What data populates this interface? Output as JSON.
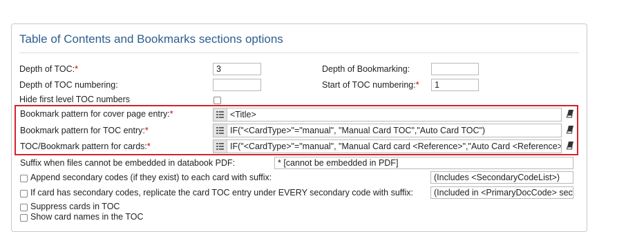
{
  "panel": {
    "title": "Table of Contents and Bookmarks sections options"
  },
  "fields": {
    "depth_toc": {
      "label": "Depth of TOC:",
      "required": "*",
      "value": "3"
    },
    "depth_bookmarking": {
      "label": "Depth of Bookmarking:",
      "value": ""
    },
    "depth_toc_numbering": {
      "label": "Depth of TOC numbering:",
      "value": ""
    },
    "start_toc_numbering": {
      "label": "Start of TOC numbering:",
      "required": "*",
      "value": "1"
    },
    "hide_first_level": {
      "label": "Hide first level TOC numbers",
      "checked": false
    }
  },
  "patterns": {
    "cover": {
      "label": "Bookmark pattern for cover page entry:",
      "required": "*",
      "value": "<Title>"
    },
    "toc": {
      "label": "Bookmark pattern for TOC entry:",
      "required": "*",
      "value": "IF(\"<CardType>\"=\"manual\", \"Manual Card TOC\",\"Auto Card TOC\")"
    },
    "cards": {
      "label": "TOC/Bookmark pattern for cards:",
      "required": "*",
      "value": "IF(\"<CardType>\"=\"manual\", \"Manual Card card <Reference>\",\"Auto Card <Reference>\")"
    }
  },
  "suffix": {
    "label": "Suffix when files cannot be embedded in databook PDF:",
    "value": "* [cannot be embedded in PDF]"
  },
  "options": {
    "append_secondary": {
      "label": "Append secondary codes (if they exist) to each card with suffix:",
      "value": "(Includes <SecondaryCodeList>)"
    },
    "replicate_secondary": {
      "label": "If card has secondary codes, replicate the card TOC entry under EVERY secondary code with suffix:",
      "value": "(Included in <PrimaryDocCode> sect"
    },
    "suppress_cards": {
      "label": "Suppress cards in TOC"
    },
    "cut_off": {
      "label": "Show card names in the TOC"
    }
  }
}
